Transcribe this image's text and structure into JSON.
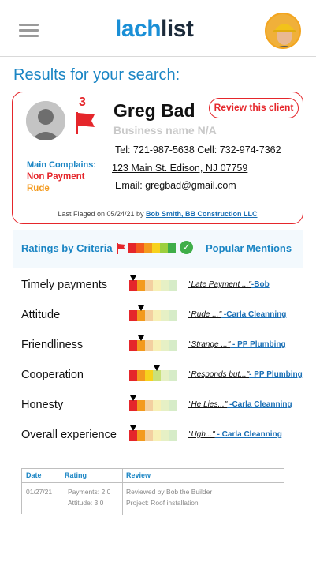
{
  "header": {
    "logo_part1": "lach",
    "logo_part2": "list"
  },
  "page_title": "Results for your search:",
  "client": {
    "flag_count": "3",
    "name": "Greg Bad",
    "business": "Business name N/A",
    "review_button": "Review this client",
    "phones": "Tel: 721-987-5638  Cell: 732-974-7362",
    "address": "123 Main St. Edison,  NJ 07759",
    "email": "Email: gregbad@gmail.com",
    "main_complaints_label": "Main Complains:",
    "complaints": [
      "Non Payment",
      "Rude"
    ],
    "last_flagged_text": "Last Flaged on 05/24/21 by",
    "last_flagged_by": "Bob Smith, BB Construction LLC"
  },
  "criteria_header": {
    "ratings_label": "Ratings by Criteria",
    "popular_label": "Popular Mentions",
    "check_icon": "✓"
  },
  "meter_colors": [
    "#e5262b",
    "#f39a1e",
    "#f3d0a0",
    "#f7f0b6",
    "#e6f0c5",
    "#d6ecc8"
  ],
  "legend_colors": [
    "#e5262b",
    "#f35a1e",
    "#f39a1e",
    "#f7d21e",
    "#9ccf3e",
    "#3fae49"
  ],
  "ratings": [
    {
      "label": "Timely payments",
      "level": 0.1,
      "quote": "\"Late Payment ...\"",
      "who": "-Bob"
    },
    {
      "label": "Attitude",
      "level": 0.3,
      "quote": "\"Rude ...\"",
      "who": " -Carla Cleanning"
    },
    {
      "label": "Friendliness",
      "level": 0.3,
      "quote": "\"Strange ...\"",
      "who": " - PP Plumbing"
    },
    {
      "label": "Cooperation",
      "level": 0.7,
      "quote": "\"Responds but...\"",
      "who": "- PP Plumbing"
    },
    {
      "label": "Honesty",
      "level": 0.1,
      "quote": "\"He Lies...\"",
      "who": " -Carla Cleanning"
    },
    {
      "label": "Overall experience",
      "level": 0.1,
      "quote": "\"Ugh...\"",
      "who": " - Carla Cleanning"
    }
  ],
  "review_table": {
    "headers": [
      "Date",
      "Rating",
      "Review"
    ],
    "row": {
      "date": "01/27/21",
      "rating_1": "Payments: 2.0",
      "rating_2": "Attitude: 3.0",
      "review_1": "Reviewed by Bob the Builder",
      "review_2": "Project: Roof installation"
    }
  }
}
